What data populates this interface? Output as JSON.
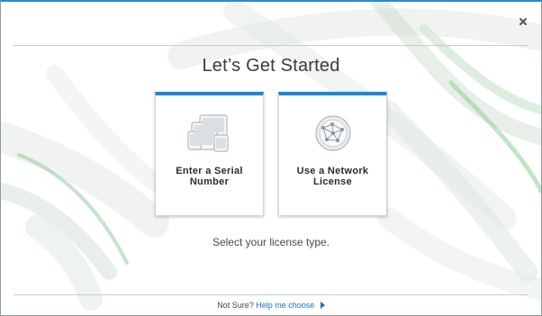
{
  "dialog": {
    "title": "Let’s Get Started",
    "subtitle": "Select your license type.",
    "close_icon": "close-icon"
  },
  "options": [
    {
      "label": "Enter a Serial Number",
      "icon": "devices-icon"
    },
    {
      "label": "Use a Network License",
      "icon": "network-globe-icon"
    }
  ],
  "footer": {
    "prompt": "Not Sure?",
    "link_label": "Help me choose",
    "link_icon": "play-arrow-icon"
  },
  "colors": {
    "accent": "#1f86d0",
    "link": "#1f6fc0",
    "title_text": "#3b3b3b"
  }
}
